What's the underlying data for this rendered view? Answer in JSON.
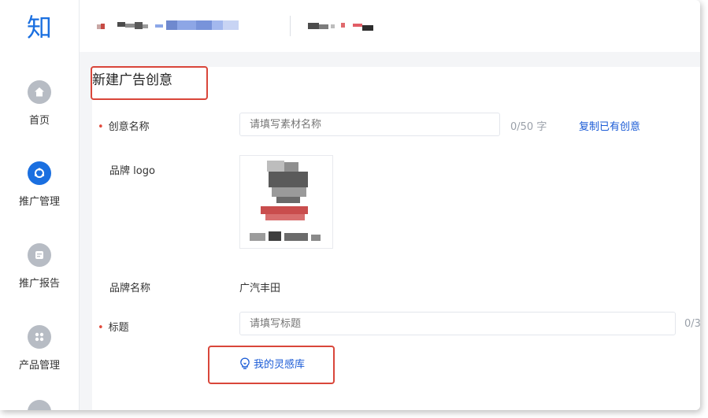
{
  "sidebar": {
    "logo_text": "知",
    "items": [
      {
        "label": "首页",
        "icon": "home-icon",
        "active": false
      },
      {
        "label": "推广管理",
        "icon": "promotion-icon",
        "active": true
      },
      {
        "label": "推广报告",
        "icon": "report-icon",
        "active": false
      },
      {
        "label": "产品管理",
        "icon": "grid-icon",
        "active": false
      }
    ]
  },
  "form": {
    "title": "新建广告创意",
    "creative_name": {
      "label": "创意名称",
      "required": true,
      "placeholder": "请填写素材名称",
      "counter": "0/50 字",
      "copy_link": "复制已有创意"
    },
    "brand_logo": {
      "label": "品牌 logo"
    },
    "brand_name": {
      "label": "品牌名称",
      "value": "广汽丰田"
    },
    "headline": {
      "label": "标题",
      "required": true,
      "placeholder": "请填写标题",
      "counter": "0/3"
    },
    "inspiration_button": "我的灵感库"
  },
  "colors": {
    "accent": "#1a6fe0",
    "highlight_box": "#d9463a",
    "required_dot": "#e24a3b"
  }
}
